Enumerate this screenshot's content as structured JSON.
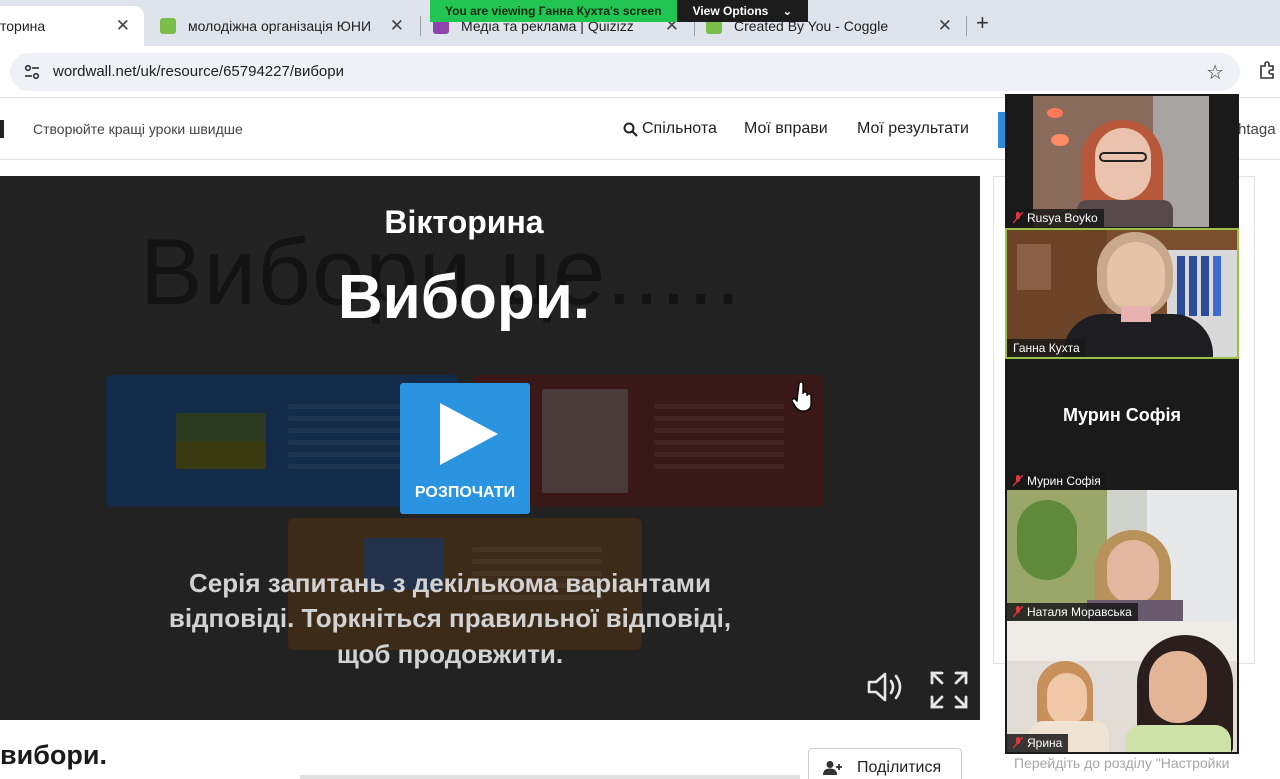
{
  "browser": {
    "tabs": [
      {
        "title": "торина",
        "active": true,
        "favicon_color": "#ffffff"
      },
      {
        "title": "молодіжна організація ЮНИ",
        "active": false,
        "favicon_color": "#7bbf4a"
      },
      {
        "title": "Медіа та реклама | Quizizz",
        "active": false,
        "favicon_color": "#8e44ad"
      },
      {
        "title": "Created By You - Coggle",
        "active": false,
        "favicon_color": "#7bbf4a"
      }
    ],
    "close_glyph": "✕",
    "new_tab_glyph": "+",
    "url": "wordwall.net/uk/resource/65794227/вибори",
    "bookmark_icon": "star-icon"
  },
  "screen_share": {
    "message": "You are viewing Ганна Кухта's screen",
    "options_label": "View Options",
    "options_chevron": "⌄"
  },
  "site": {
    "tagline": "Створюйте кращі уроки швидше",
    "nav": [
      "Спільнота",
      "Мої вправи",
      "Мої результати"
    ],
    "account_partial": "htaga"
  },
  "activity": {
    "background_title": "Вибори це.....",
    "type": "Вікторина",
    "title": "Вибори.",
    "start_label": "РОЗПОЧАТИ",
    "description": "Серія запитань з декількома варіантами відповіді. Торкніться правильної відповіді, щоб продовжити.",
    "page_title": "вибори.",
    "share_label": "Поділитися"
  },
  "windows_activation": "Перейдіть до розділу \"Настройки",
  "participants": [
    {
      "name": "Rusya Boyko",
      "muted": true,
      "video": true,
      "speaking": false
    },
    {
      "name": "Ганна Кухта",
      "muted": false,
      "video": true,
      "speaking": true
    },
    {
      "name": "Мурин Софія",
      "muted": true,
      "video": false,
      "speaking": false
    },
    {
      "name": "Наталя Моравська",
      "muted": true,
      "video": true,
      "speaking": false
    },
    {
      "name": "Ярина",
      "muted": true,
      "video": true,
      "speaking": false
    }
  ],
  "colors": {
    "accent_blue": "#2b94e1",
    "share_green": "#23c552",
    "speaking_border": "#9ac04a",
    "muted_red": "#e0323c"
  }
}
